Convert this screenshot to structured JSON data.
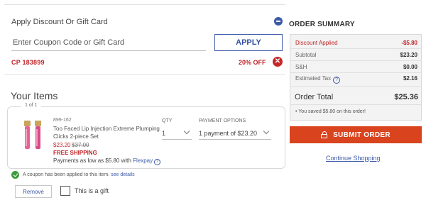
{
  "discount_section": {
    "title": "Apply Discount Or Gift Card",
    "coupon_placeholder": "Enter Coupon Code or Gift Card",
    "apply_label": "APPLY",
    "applied_code": "CP 183899",
    "applied_off": "20% OFF",
    "remove_glyph": "✕"
  },
  "items": {
    "heading": "Your Items",
    "pager": "1 of 1",
    "product": {
      "sku": "899-162",
      "name": "Too Faced Lip Injection Extreme Plumping Clicks 2-piece Set",
      "price_now": "$23.20",
      "price_was": "$37.00",
      "shipping": "FREE SHIPPING",
      "flexpay_text": "Payments as low as $5.80 with",
      "flexpay_link": "Flexpay",
      "help_glyph": "?"
    },
    "qty_label": "QTY",
    "qty_value": "1",
    "payment_label": "PAYMENT OPTIONS",
    "payment_value": "1 payment of $23.20",
    "coupon_note": "A coupon has been applied to this item.",
    "coupon_note_link": "see details",
    "remove_label": "Remove",
    "gift_label": "This is a gift"
  },
  "summary": {
    "title": "ORDER SUMMARY",
    "rows": [
      {
        "label": "Discount Applied",
        "value": "-$5.80"
      },
      {
        "label": "Subtotal",
        "value": "$23.20"
      },
      {
        "label": "S&H",
        "value": "$0.00"
      },
      {
        "label": "Estimated Tax",
        "value": "$2.16"
      }
    ],
    "help_glyph": "?",
    "total_label": "Order Total",
    "total_value": "$25.36",
    "saved_text": "You saved $5.80 on this order!",
    "bullet": "•",
    "submit_label": "SUBMIT ORDER",
    "continue_label": "Continue Shopping"
  },
  "colors": {
    "accent_red": "#c02428",
    "submit_orange": "#d9441f",
    "link_blue": "#3b5aa8",
    "success_green": "#3c9a3c"
  },
  "icons": [
    "minus-circle-icon",
    "close-icon",
    "help-icon",
    "check-circle-icon",
    "chevron-down-icon",
    "lock-icon"
  ]
}
